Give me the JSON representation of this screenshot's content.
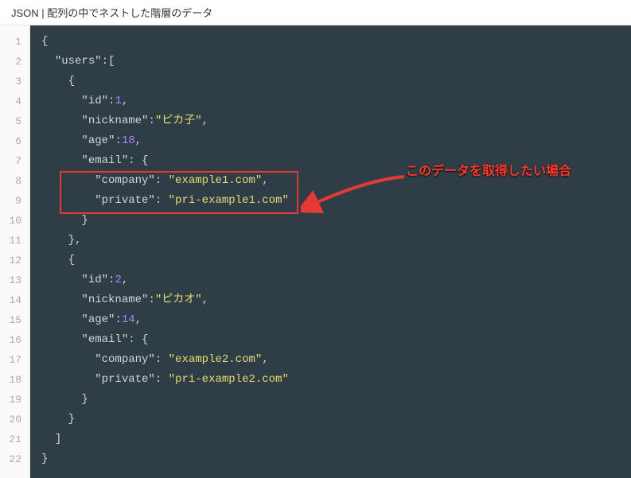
{
  "header": {
    "title": "JSON | 配列の中でネストした階層のデータ"
  },
  "annotation": {
    "text": "このデータを取得したい場合"
  },
  "code": {
    "lines": [
      {
        "indent": 0,
        "tokens": [
          {
            "t": "punc",
            "v": "{"
          }
        ]
      },
      {
        "indent": 1,
        "tokens": [
          {
            "t": "key",
            "v": "\"users\""
          },
          {
            "t": "punc",
            "v": ":["
          }
        ]
      },
      {
        "indent": 2,
        "tokens": [
          {
            "t": "punc",
            "v": "{"
          }
        ]
      },
      {
        "indent": 3,
        "tokens": [
          {
            "t": "key",
            "v": "\"id\""
          },
          {
            "t": "punc",
            "v": ":"
          },
          {
            "t": "num",
            "v": "1"
          },
          {
            "t": "punc",
            "v": ","
          }
        ]
      },
      {
        "indent": 3,
        "tokens": [
          {
            "t": "key",
            "v": "\"nickname\""
          },
          {
            "t": "punc",
            "v": ":"
          },
          {
            "t": "str",
            "v": "\"ピカ子\""
          },
          {
            "t": "punc",
            "v": ","
          }
        ]
      },
      {
        "indent": 3,
        "tokens": [
          {
            "t": "key",
            "v": "\"age\""
          },
          {
            "t": "punc",
            "v": ":"
          },
          {
            "t": "num",
            "v": "18"
          },
          {
            "t": "punc",
            "v": ","
          }
        ]
      },
      {
        "indent": 3,
        "tokens": [
          {
            "t": "key",
            "v": "\"email\""
          },
          {
            "t": "punc",
            "v": ": {"
          }
        ]
      },
      {
        "indent": 4,
        "tokens": [
          {
            "t": "key",
            "v": "\"company\""
          },
          {
            "t": "punc",
            "v": ": "
          },
          {
            "t": "str",
            "v": "\"example1.com\""
          },
          {
            "t": "punc",
            "v": ","
          }
        ]
      },
      {
        "indent": 4,
        "tokens": [
          {
            "t": "key",
            "v": "\"private\""
          },
          {
            "t": "punc",
            "v": ": "
          },
          {
            "t": "str",
            "v": "\"pri-example1.com\""
          }
        ]
      },
      {
        "indent": 3,
        "tokens": [
          {
            "t": "punc",
            "v": "}"
          }
        ]
      },
      {
        "indent": 2,
        "tokens": [
          {
            "t": "punc",
            "v": "},"
          }
        ]
      },
      {
        "indent": 2,
        "tokens": [
          {
            "t": "punc",
            "v": "{"
          }
        ]
      },
      {
        "indent": 3,
        "tokens": [
          {
            "t": "key",
            "v": "\"id\""
          },
          {
            "t": "punc",
            "v": ":"
          },
          {
            "t": "num",
            "v": "2"
          },
          {
            "t": "punc",
            "v": ","
          }
        ]
      },
      {
        "indent": 3,
        "tokens": [
          {
            "t": "key",
            "v": "\"nickname\""
          },
          {
            "t": "punc",
            "v": ":"
          },
          {
            "t": "str",
            "v": "\"ピカオ\""
          },
          {
            "t": "punc",
            "v": ","
          }
        ]
      },
      {
        "indent": 3,
        "tokens": [
          {
            "t": "key",
            "v": "\"age\""
          },
          {
            "t": "punc",
            "v": ":"
          },
          {
            "t": "num",
            "v": "14"
          },
          {
            "t": "punc",
            "v": ","
          }
        ]
      },
      {
        "indent": 3,
        "tokens": [
          {
            "t": "key",
            "v": "\"email\""
          },
          {
            "t": "punc",
            "v": ": {"
          }
        ]
      },
      {
        "indent": 4,
        "tokens": [
          {
            "t": "key",
            "v": "\"company\""
          },
          {
            "t": "punc",
            "v": ": "
          },
          {
            "t": "str",
            "v": "\"example2.com\""
          },
          {
            "t": "punc",
            "v": ","
          }
        ]
      },
      {
        "indent": 4,
        "tokens": [
          {
            "t": "key",
            "v": "\"private\""
          },
          {
            "t": "punc",
            "v": ": "
          },
          {
            "t": "str",
            "v": "\"pri-example2.com\""
          }
        ]
      },
      {
        "indent": 3,
        "tokens": [
          {
            "t": "punc",
            "v": "}"
          }
        ]
      },
      {
        "indent": 2,
        "tokens": [
          {
            "t": "punc",
            "v": "}"
          }
        ]
      },
      {
        "indent": 1,
        "tokens": [
          {
            "t": "punc",
            "v": "]"
          }
        ]
      },
      {
        "indent": 0,
        "tokens": [
          {
            "t": "punc",
            "v": "}"
          }
        ]
      }
    ]
  },
  "gutter": {
    "count": 22
  }
}
